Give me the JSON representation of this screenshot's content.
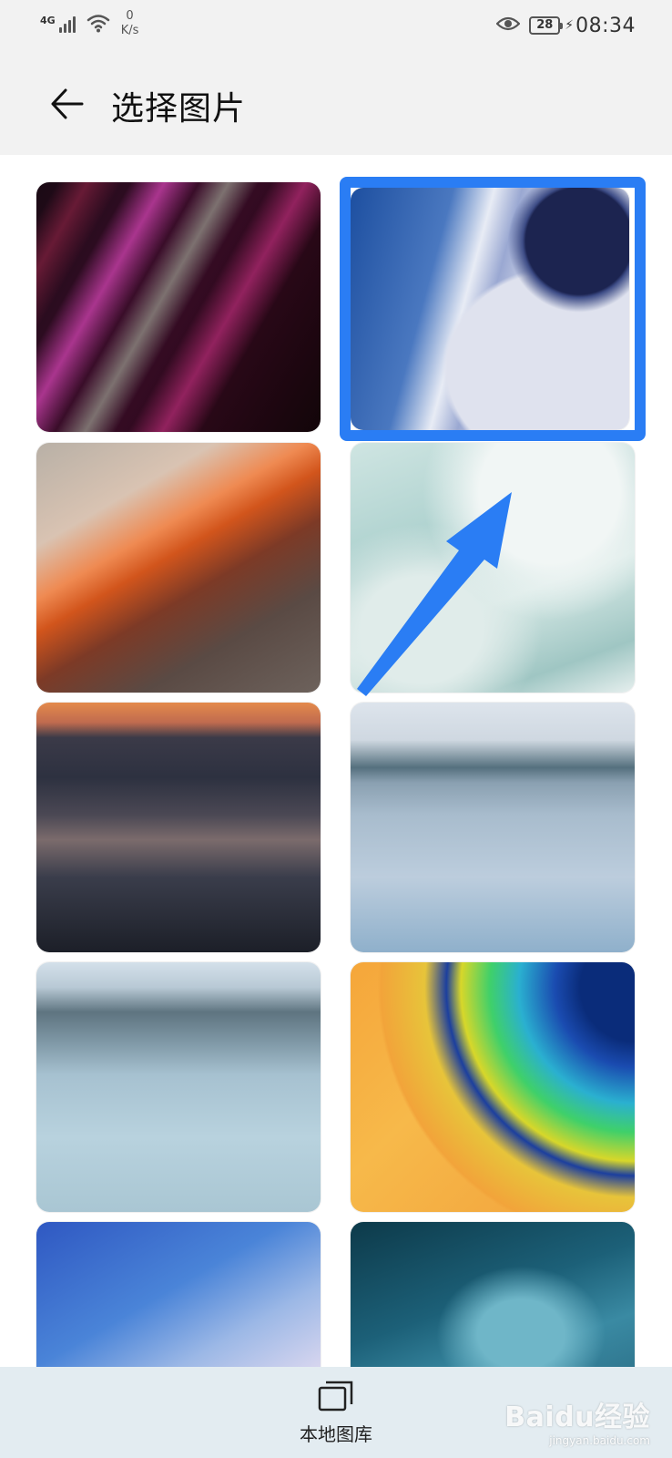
{
  "status_bar": {
    "network_type": "4G",
    "net_speed_value": "0",
    "net_speed_unit": "K/s",
    "battery_level": "28",
    "time": "08:34"
  },
  "header": {
    "title": "选择图片",
    "back_icon": "arrow-left-icon"
  },
  "wallpapers": [
    {
      "id_label": "wallpaper-1",
      "selected": false
    },
    {
      "id_label": "wallpaper-2",
      "selected": true
    },
    {
      "id_label": "wallpaper-3",
      "selected": false
    },
    {
      "id_label": "wallpaper-4",
      "selected": false
    },
    {
      "id_label": "wallpaper-5",
      "selected": false
    },
    {
      "id_label": "wallpaper-6",
      "selected": false
    },
    {
      "id_label": "wallpaper-7",
      "selected": false
    },
    {
      "id_label": "wallpaper-8",
      "selected": false
    },
    {
      "id_label": "wallpaper-9",
      "selected": false
    },
    {
      "id_label": "wallpaper-10",
      "selected": false
    }
  ],
  "bottom_bar": {
    "local_gallery_label": "本地图库",
    "local_gallery_icon": "gallery-stack-icon"
  },
  "watermark": {
    "logo": "Baidu经验",
    "url": "jingyan.baidu.com"
  },
  "colors": {
    "selection": "#2a7df4",
    "annotation_arrow": "#2a7df4"
  }
}
